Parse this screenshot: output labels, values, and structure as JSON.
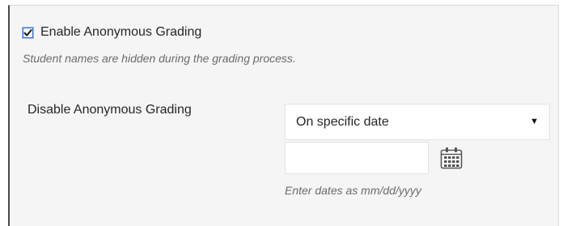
{
  "anonymous_grading": {
    "enable_label": "Enable Anonymous Grading",
    "enable_checked": true,
    "help_text": "Student names are hidden during the grading process."
  },
  "disable_field": {
    "label": "Disable Anonymous Grading",
    "select_value": "On specific date",
    "select_caret_icon": "caret-down-icon",
    "date_value": "",
    "calendar_icon": "calendar-icon",
    "date_hint": "Enter dates as mm/dd/yyyy"
  },
  "colors": {
    "checkbox_accent": "#2a6bd1",
    "panel_background": "#f5f5f5",
    "help_text": "#6b6b6b"
  }
}
